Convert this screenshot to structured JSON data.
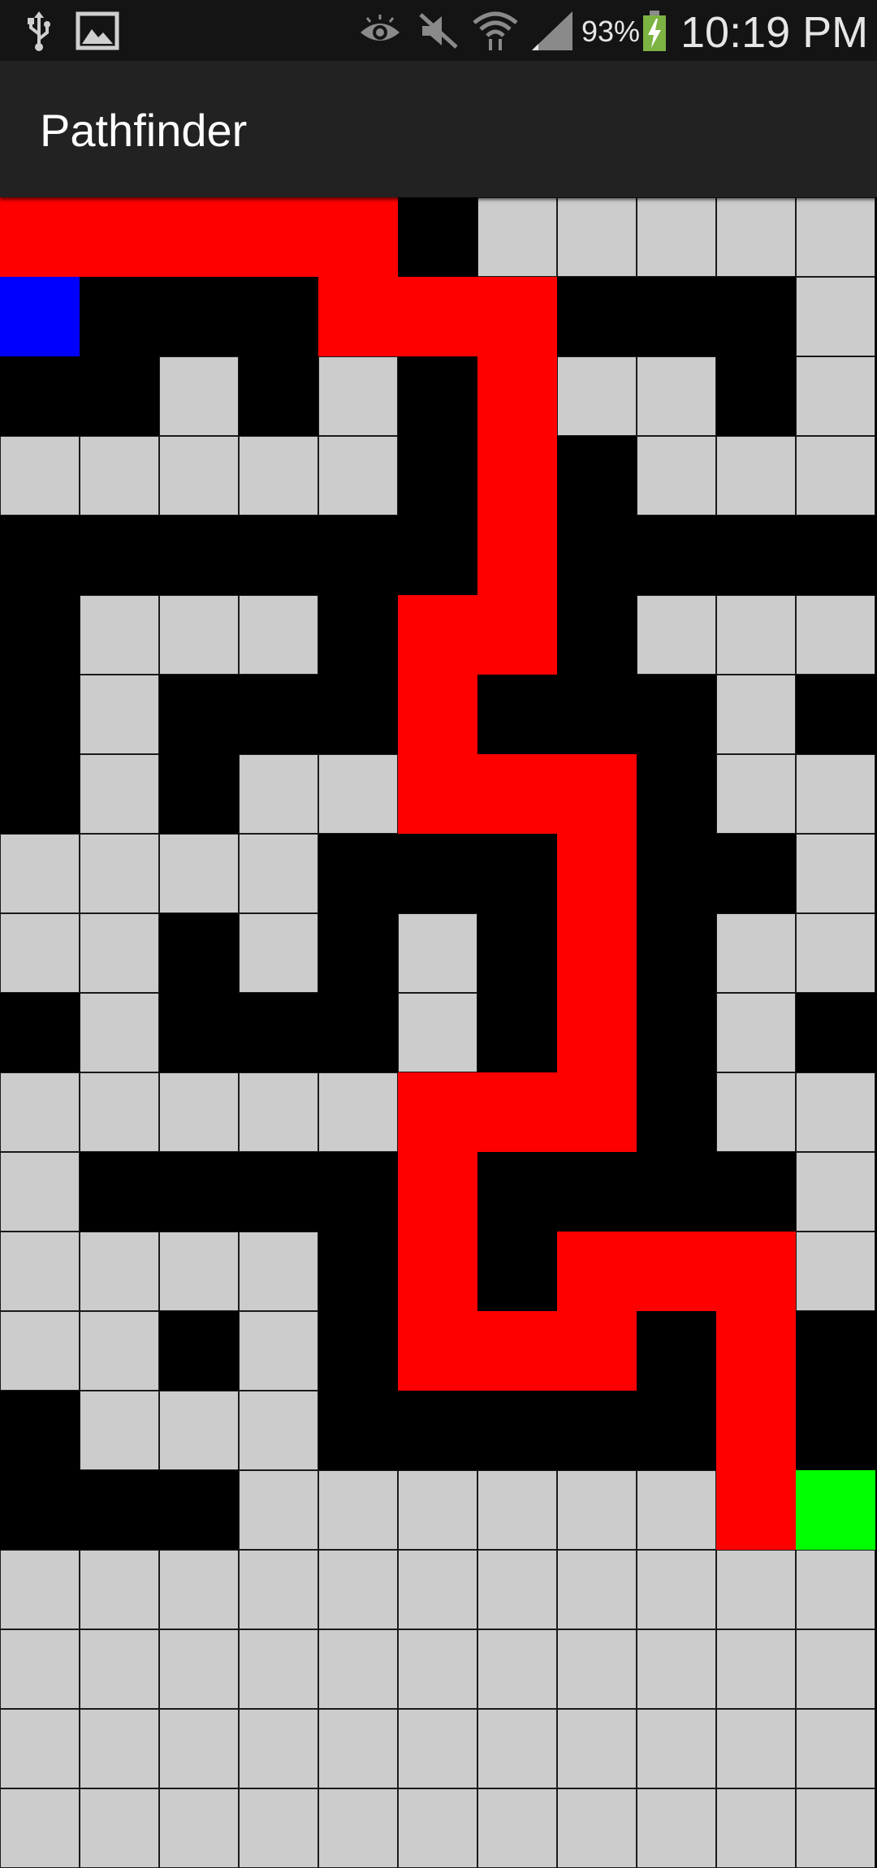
{
  "status_bar": {
    "battery_percent": "93%",
    "time": "10:19 PM",
    "icons": [
      "usb-icon",
      "image-icon",
      "eye-icon",
      "mute-icon",
      "wifi-icon",
      "signal-icon",
      "battery-charging-icon"
    ]
  },
  "action_bar": {
    "title": "Pathfinder"
  },
  "maze": {
    "columns": 11,
    "rows": 21,
    "legend": {
      "0": "open",
      "1": "wall",
      "2": "path",
      "3": "start",
      "4": "goal"
    },
    "colors": {
      "open": "#cccccc",
      "wall": "#000000",
      "path": "#ff0000",
      "start": "#0000ff",
      "goal": "#00ff00"
    },
    "cells": [
      [
        2,
        2,
        2,
        2,
        2,
        1,
        0,
        0,
        0,
        0,
        0
      ],
      [
        3,
        1,
        1,
        1,
        2,
        2,
        2,
        1,
        1,
        1,
        0
      ],
      [
        1,
        1,
        0,
        1,
        0,
        1,
        2,
        0,
        0,
        1,
        0
      ],
      [
        0,
        0,
        0,
        0,
        0,
        1,
        2,
        1,
        0,
        0,
        0
      ],
      [
        1,
        1,
        1,
        1,
        1,
        1,
        2,
        1,
        1,
        1,
        1
      ],
      [
        1,
        0,
        0,
        0,
        1,
        2,
        2,
        1,
        0,
        0,
        0
      ],
      [
        1,
        0,
        1,
        1,
        1,
        2,
        1,
        1,
        1,
        0,
        1
      ],
      [
        1,
        0,
        1,
        0,
        0,
        2,
        2,
        2,
        1,
        0,
        0
      ],
      [
        0,
        0,
        0,
        0,
        1,
        1,
        1,
        2,
        1,
        1,
        0
      ],
      [
        0,
        0,
        1,
        0,
        1,
        0,
        1,
        2,
        1,
        0,
        0
      ],
      [
        1,
        0,
        1,
        1,
        1,
        0,
        1,
        2,
        1,
        0,
        1
      ],
      [
        0,
        0,
        0,
        0,
        0,
        2,
        2,
        2,
        1,
        0,
        0
      ],
      [
        0,
        1,
        1,
        1,
        1,
        2,
        1,
        1,
        1,
        1,
        0
      ],
      [
        0,
        0,
        0,
        0,
        1,
        2,
        1,
        2,
        2,
        2,
        0
      ],
      [
        0,
        0,
        1,
        0,
        1,
        2,
        2,
        2,
        1,
        2,
        1
      ],
      [
        1,
        0,
        0,
        0,
        1,
        1,
        1,
        1,
        1,
        2,
        1
      ],
      [
        1,
        1,
        1,
        0,
        0,
        0,
        0,
        0,
        0,
        2,
        4
      ],
      [
        0,
        0,
        0,
        0,
        0,
        0,
        0,
        0,
        0,
        0,
        0
      ],
      [
        0,
        0,
        0,
        0,
        0,
        0,
        0,
        0,
        0,
        0,
        0
      ],
      [
        0,
        0,
        0,
        0,
        0,
        0,
        0,
        0,
        0,
        0,
        0
      ],
      [
        0,
        0,
        0,
        0,
        0,
        0,
        0,
        0,
        0,
        0,
        0
      ]
    ]
  }
}
